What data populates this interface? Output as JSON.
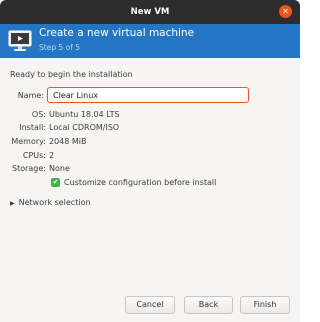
{
  "window": {
    "title": "New VM"
  },
  "banner": {
    "title": "Create a new virtual machine",
    "step": "Step 5 of 5"
  },
  "content": {
    "ready_text": "Ready to begin the installation",
    "name": {
      "label": "Name:",
      "value": "Clear Linux"
    },
    "details": [
      {
        "label": "OS:",
        "value": "Ubuntu 18.04 LTS"
      },
      {
        "label": "Install:",
        "value": "Local CDROM/ISO"
      },
      {
        "label": "Memory:",
        "value": "2048 MiB"
      },
      {
        "label": "CPUs:",
        "value": "2"
      },
      {
        "label": "Storage:",
        "value": "None"
      }
    ],
    "customize": {
      "label": "Customize configuration before install",
      "checked": true
    },
    "network_expander": "Network selection"
  },
  "buttons": {
    "cancel": "Cancel",
    "back": "Back",
    "finish": "Finish"
  },
  "colors": {
    "accent": "#e95420",
    "banner": "#2476c5",
    "check": "#3eb34f"
  }
}
